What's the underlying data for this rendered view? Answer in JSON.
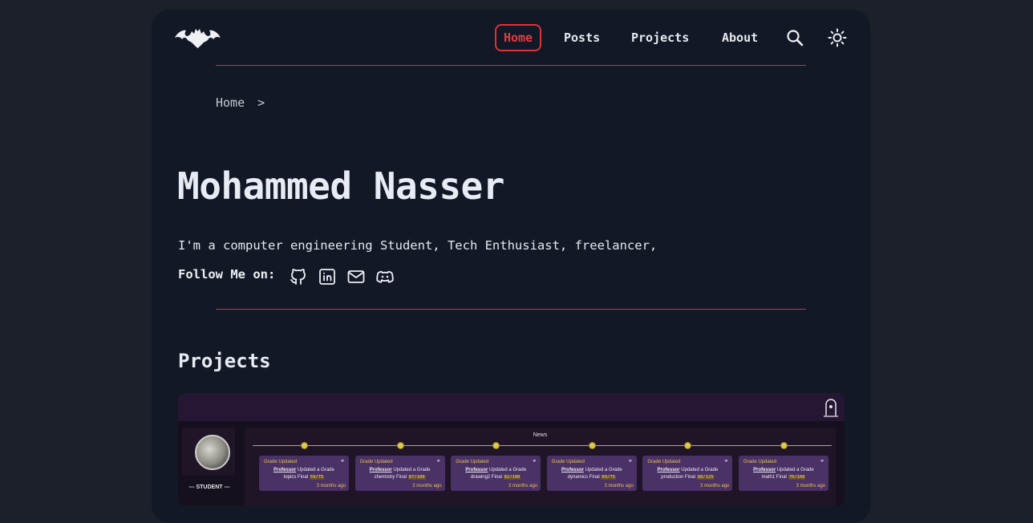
{
  "nav": {
    "items": [
      {
        "label": "Home",
        "active": true
      },
      {
        "label": "Posts"
      },
      {
        "label": "Projects"
      },
      {
        "label": "About"
      }
    ],
    "search_icon": "search-icon",
    "theme_icon": "sun-icon"
  },
  "breadcrumb": {
    "home": "Home",
    "separator": ">"
  },
  "hero": {
    "name": "Mohammed Nasser",
    "bio": "I'm a computer engineering Student, Tech Enthusiast, freelancer,",
    "follow_label": "Follow Me on:",
    "socials": [
      "github-icon",
      "linkedin-icon",
      "mail-icon",
      "discord-icon"
    ]
  },
  "projects": {
    "heading": "Projects",
    "preview": {
      "news_label": "News",
      "student_label": "--- STUDENT ---",
      "cards": [
        {
          "header": "Grade Updated",
          "actor": "Professor",
          "action": "Updated a Grade",
          "item": "topics Final",
          "score": "59/75",
          "time": "3 months ago"
        },
        {
          "header": "Grade Updated",
          "actor": "Professor",
          "action": "Updated a Grade",
          "item": "chemistry Final",
          "score": "87/100",
          "time": "3 months ago"
        },
        {
          "header": "Grade Updated",
          "actor": "Professor",
          "action": "Updated a Grade",
          "item": "drawing2 Final",
          "score": "82/100",
          "time": "3 months ago"
        },
        {
          "header": "Grade Updated",
          "actor": "Professor",
          "action": "Updated a Grade",
          "item": "dynamics Final",
          "score": "60/75",
          "time": "3 months ago"
        },
        {
          "header": "Grade Updated",
          "actor": "Professor",
          "action": "Updated a Grade",
          "item": "production Final",
          "score": "98/125",
          "time": "3 months ago"
        },
        {
          "header": "Grade Updated",
          "actor": "Professor",
          "action": "Updated a Grade",
          "item": "math1 Final",
          "score": "70/100",
          "time": "3 months ago"
        }
      ]
    }
  },
  "colors": {
    "accent": "#d8343a",
    "background": "#1b202b",
    "card": "#121826"
  }
}
